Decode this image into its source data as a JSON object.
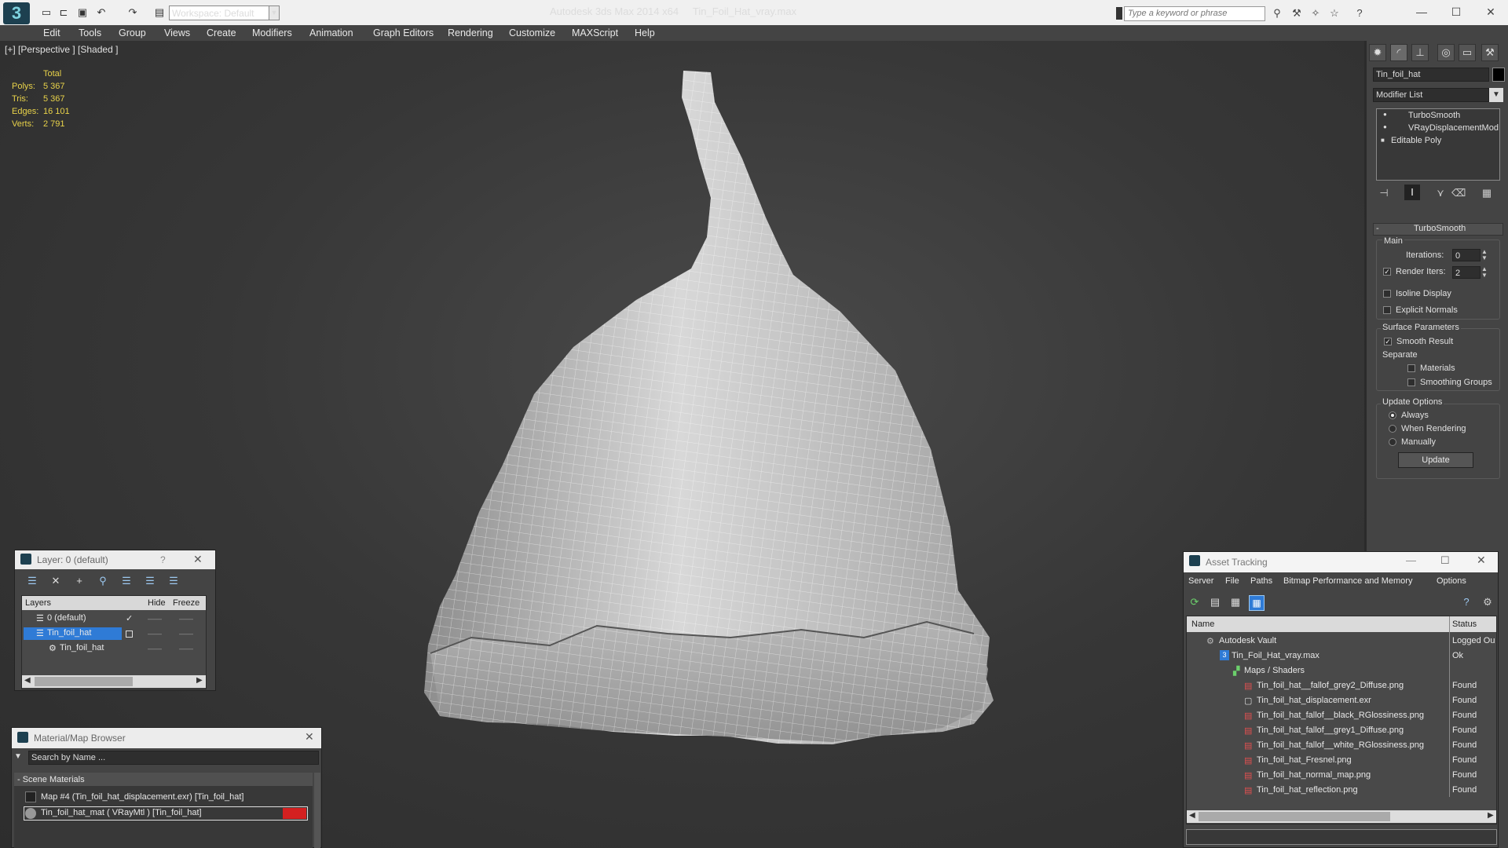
{
  "title_bar": {
    "workspace": "Workspace: Default",
    "app_name": "Autodesk 3ds Max  2014 x64",
    "file_name": "Tin_Foil_Hat_vray.max",
    "search_placeholder": "Type a keyword or phrase"
  },
  "menu": [
    "Edit",
    "Tools",
    "Group",
    "Views",
    "Create",
    "Modifiers",
    "Animation",
    "Graph Editors",
    "Rendering",
    "Customize",
    "MAXScript",
    "Help"
  ],
  "viewport": {
    "label": "[+] [Perspective ] [Shaded ]",
    "stats_header": "Total",
    "stats": [
      {
        "label": "Polys:",
        "value": "5 367"
      },
      {
        "label": "Tris:",
        "value": "5 367"
      },
      {
        "label": "Edges:",
        "value": "16 101"
      },
      {
        "label": "Verts:",
        "value": "2 791"
      }
    ]
  },
  "command_panel": {
    "object_name": "Tin_foil_hat",
    "modifier_list": "Modifier List",
    "stack": [
      "TurboSmooth",
      "VRayDisplacementMod",
      "Editable Poly"
    ],
    "rollout_title": "TurboSmooth",
    "main_label": "Main",
    "iterations_label": "Iterations:",
    "iterations_value": "0",
    "render_iters_label": "Render Iters:",
    "render_iters_value": "2",
    "isoline_label": "Isoline Display",
    "explicit_label": "Explicit Normals",
    "surface_label": "Surface Parameters",
    "smooth_label": "Smooth Result",
    "separate_label": "Separate",
    "materials_label": "Materials",
    "smoothing_label": "Smoothing Groups",
    "update_options_label": "Update Options",
    "always_label": "Always",
    "when_rendering_label": "When Rendering",
    "manually_label": "Manually",
    "update_button": "Update"
  },
  "layer_window": {
    "title": "Layer: 0 (default)",
    "help": "?",
    "col_layers": "Layers",
    "col_hide": "Hide",
    "col_freeze": "Freeze",
    "rows": [
      "0 (default)",
      "Tin_foil_hat",
      "Tin_foil_hat"
    ]
  },
  "material_browser": {
    "title": "Material/Map Browser",
    "search_placeholder": "Search by Name ...",
    "section": "- Scene Materials",
    "items": [
      "Map #4 (Tin_foil_hat_displacement.exr)  [Tin_foil_hat]",
      "Tin_foil_hat_mat  ( VRayMtl )  [Tin_foil_hat]"
    ]
  },
  "asset_tracking": {
    "title": "Asset Tracking",
    "menu": [
      "Server",
      "File",
      "Paths",
      "Bitmap Performance and Memory",
      "Options"
    ],
    "col_name": "Name",
    "col_status": "Status",
    "rows": [
      {
        "name": "Autodesk Vault",
        "status": "Logged Ou"
      },
      {
        "name": "Tin_Foil_Hat_vray.max",
        "status": "Ok"
      },
      {
        "name": "Maps / Shaders",
        "status": ""
      },
      {
        "name": "Tin_foil_hat__fallof_grey2_Diffuse.png",
        "status": "Found"
      },
      {
        "name": "Tin_foil_hat_displacement.exr",
        "status": "Found"
      },
      {
        "name": "Tin_foil_hat_fallof__black_RGlossiness.png",
        "status": "Found"
      },
      {
        "name": "Tin_foil_hat_fallof__grey1_Diffuse.png",
        "status": "Found"
      },
      {
        "name": "Tin_foil_hat_fallof__white_RGlossiness.png",
        "status": "Found"
      },
      {
        "name": "Tin_foil_hat_Fresnel.png",
        "status": "Found"
      },
      {
        "name": "Tin_foil_hat_normal_map.png",
        "status": "Found"
      },
      {
        "name": "Tin_foil_hat_reflection.png",
        "status": "Found"
      }
    ]
  },
  "colors": {
    "selection": "#2f7bd6",
    "stat_text": "#e8d24a",
    "material_swatch": "#d42020"
  }
}
